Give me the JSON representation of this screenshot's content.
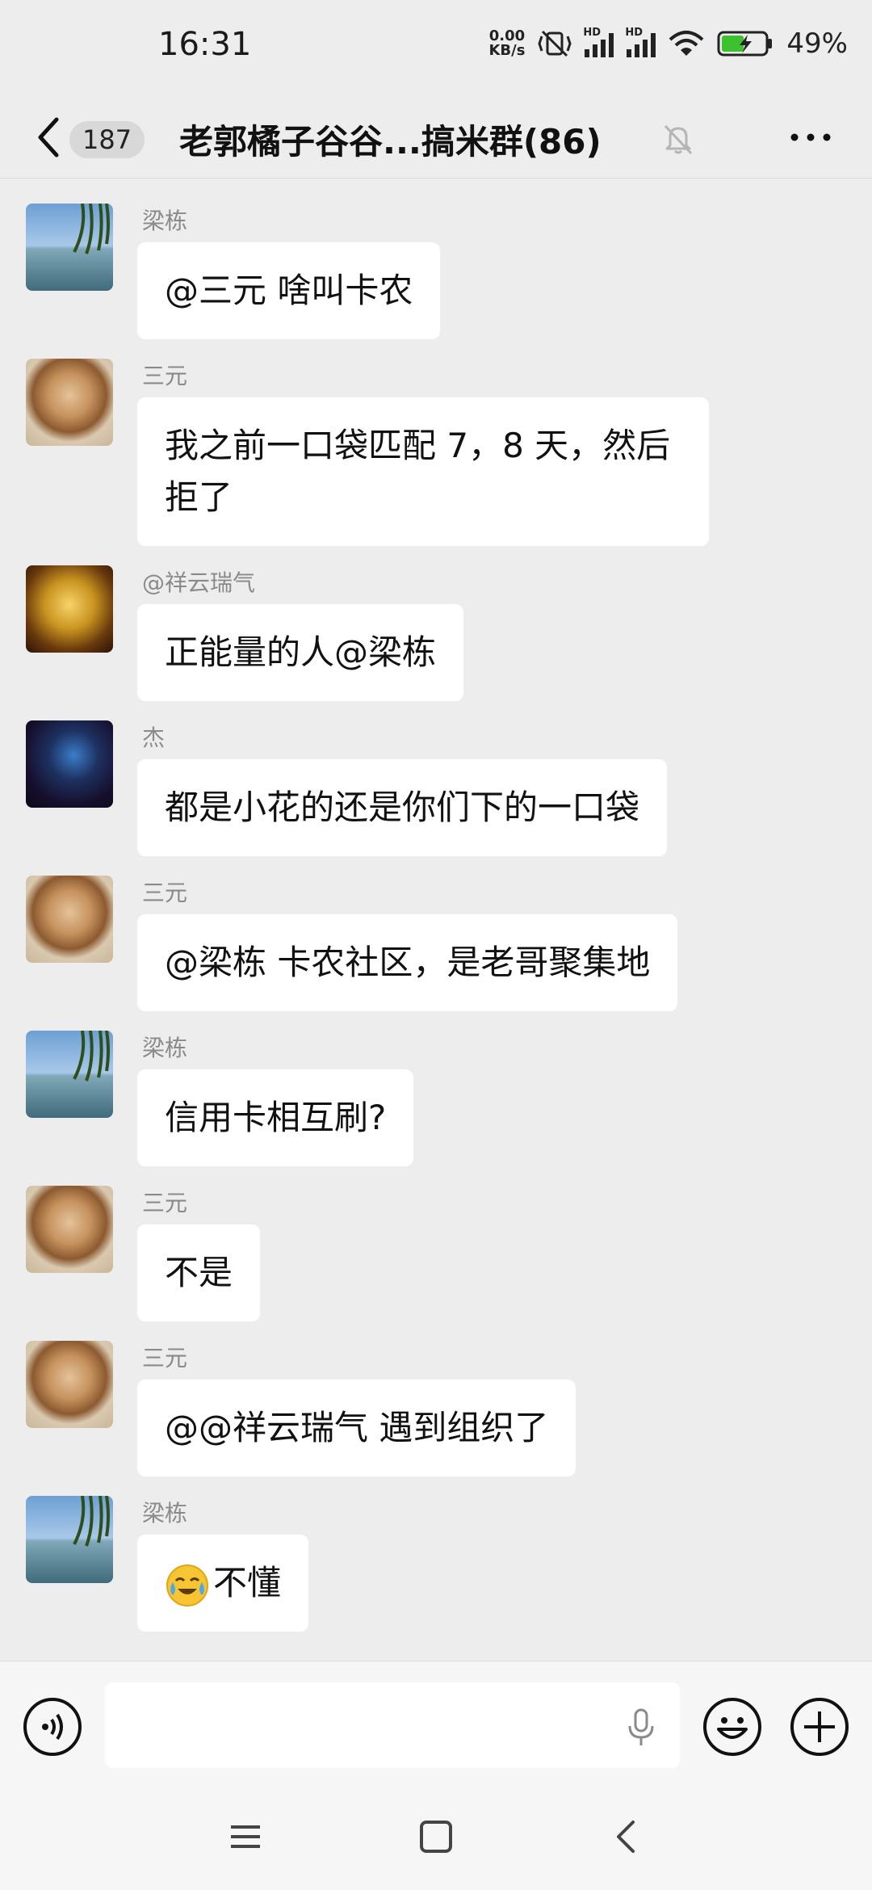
{
  "status_bar": {
    "time": "16:31",
    "net_speed_value": "0.00",
    "net_speed_unit": "KB/s",
    "signal1_label": "HD",
    "signal2_label": "HD",
    "battery_percent": "49%",
    "icons": [
      "mute-vibrate-icon",
      "signal-icon",
      "signal-icon",
      "wifi-icon",
      "battery-charging-icon"
    ]
  },
  "header": {
    "unread_count": "187",
    "title": "老郭橘子谷谷...搞米群(86)",
    "icons": [
      "back-icon",
      "mute-bell-icon",
      "more-icon"
    ]
  },
  "messages": [
    {
      "sender": "梁栋",
      "text": "@三元  啥叫卡农",
      "avatar": "lake-willow-avatar"
    },
    {
      "sender": "三元",
      "text": "我之前一口袋匹配 7，8 天，然后拒了",
      "avatar": "lion-cat-avatar"
    },
    {
      "sender": "@祥云瑞气",
      "text": "正能量的人@梁栋",
      "avatar": "golden-statue-avatar"
    },
    {
      "sender": "杰",
      "text": "都是小花的还是你们下的一口袋",
      "avatar": "dark-smoke-avatar"
    },
    {
      "sender": "三元",
      "text": "@梁栋  卡农社区，是老哥聚集地",
      "avatar": "lion-cat-avatar"
    },
    {
      "sender": "梁栋",
      "text": "信用卡相互刷?",
      "avatar": "lake-willow-avatar"
    },
    {
      "sender": "三元",
      "text": "不是",
      "avatar": "lion-cat-avatar"
    },
    {
      "sender": "三元",
      "text": "@@祥云瑞气  遇到组织了",
      "avatar": "lion-cat-avatar"
    },
    {
      "sender": "梁栋",
      "emoji": "crying-laughing-emoji",
      "text": "不懂",
      "avatar": "lake-willow-avatar"
    }
  ],
  "input_bar": {
    "placeholder": "",
    "icons": [
      "voice-icon",
      "mic-icon",
      "emoji-icon",
      "plus-icon"
    ]
  },
  "nav_bar": {
    "icons": [
      "menu-icon",
      "home-icon",
      "back-icon"
    ]
  }
}
